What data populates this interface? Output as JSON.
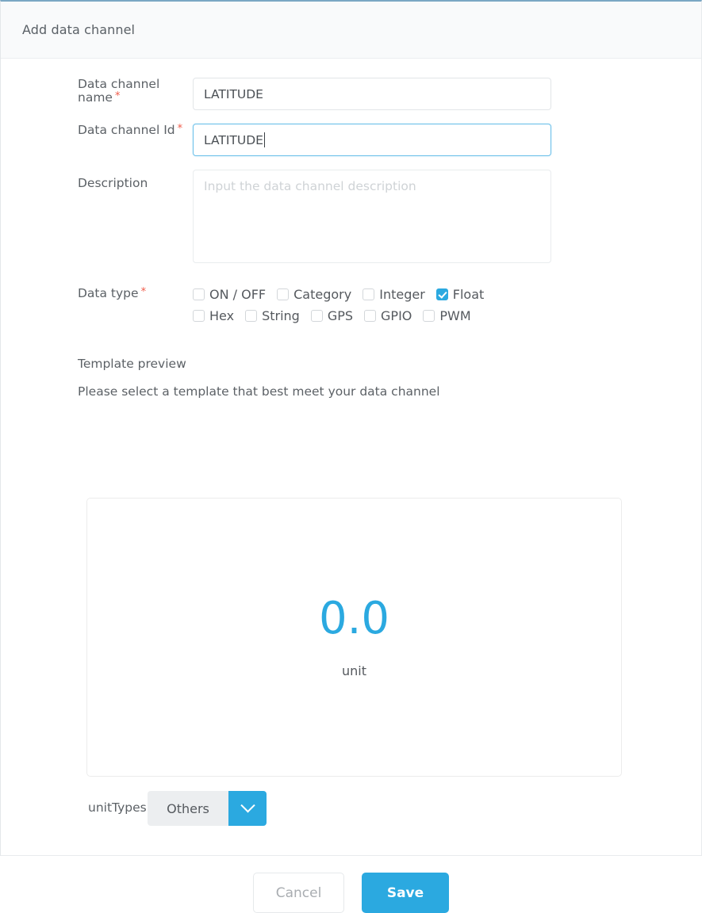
{
  "dialog": {
    "title": "Add data channel"
  },
  "fields": {
    "name": {
      "label": "Data channel name",
      "required_mark": "*",
      "value": "LATITUDE"
    },
    "id": {
      "label": "Data channel Id",
      "required_mark": "*",
      "value": "LATITUDE",
      "focused": true
    },
    "description": {
      "label": "Description",
      "value": "",
      "placeholder": "Input the data channel description"
    },
    "data_type": {
      "label": "Data type",
      "required_mark": "*",
      "options": [
        {
          "label": "ON / OFF",
          "checked": false
        },
        {
          "label": "Category",
          "checked": false
        },
        {
          "label": "Integer",
          "checked": false
        },
        {
          "label": "Float",
          "checked": true
        },
        {
          "label": "Hex",
          "checked": false
        },
        {
          "label": "String",
          "checked": false
        },
        {
          "label": "GPS",
          "checked": false
        },
        {
          "label": "GPIO",
          "checked": false
        },
        {
          "label": "PWM",
          "checked": false
        }
      ]
    },
    "unit_types": {
      "label": "unitTypes",
      "required_mark": "*",
      "selected": "Others",
      "chevron_icon": "chevron-down-icon"
    }
  },
  "template_preview": {
    "heading": "Template preview",
    "subheading": "Please select a template that best meet your data channel",
    "value": "0.0",
    "unit": "unit"
  },
  "footer": {
    "cancel_label": "Cancel",
    "save_label": "Save"
  },
  "colors": {
    "accent": "#2ba9e0",
    "required": "#f05b4a",
    "text": "#5c6166",
    "header_bg": "#f9fafb"
  }
}
